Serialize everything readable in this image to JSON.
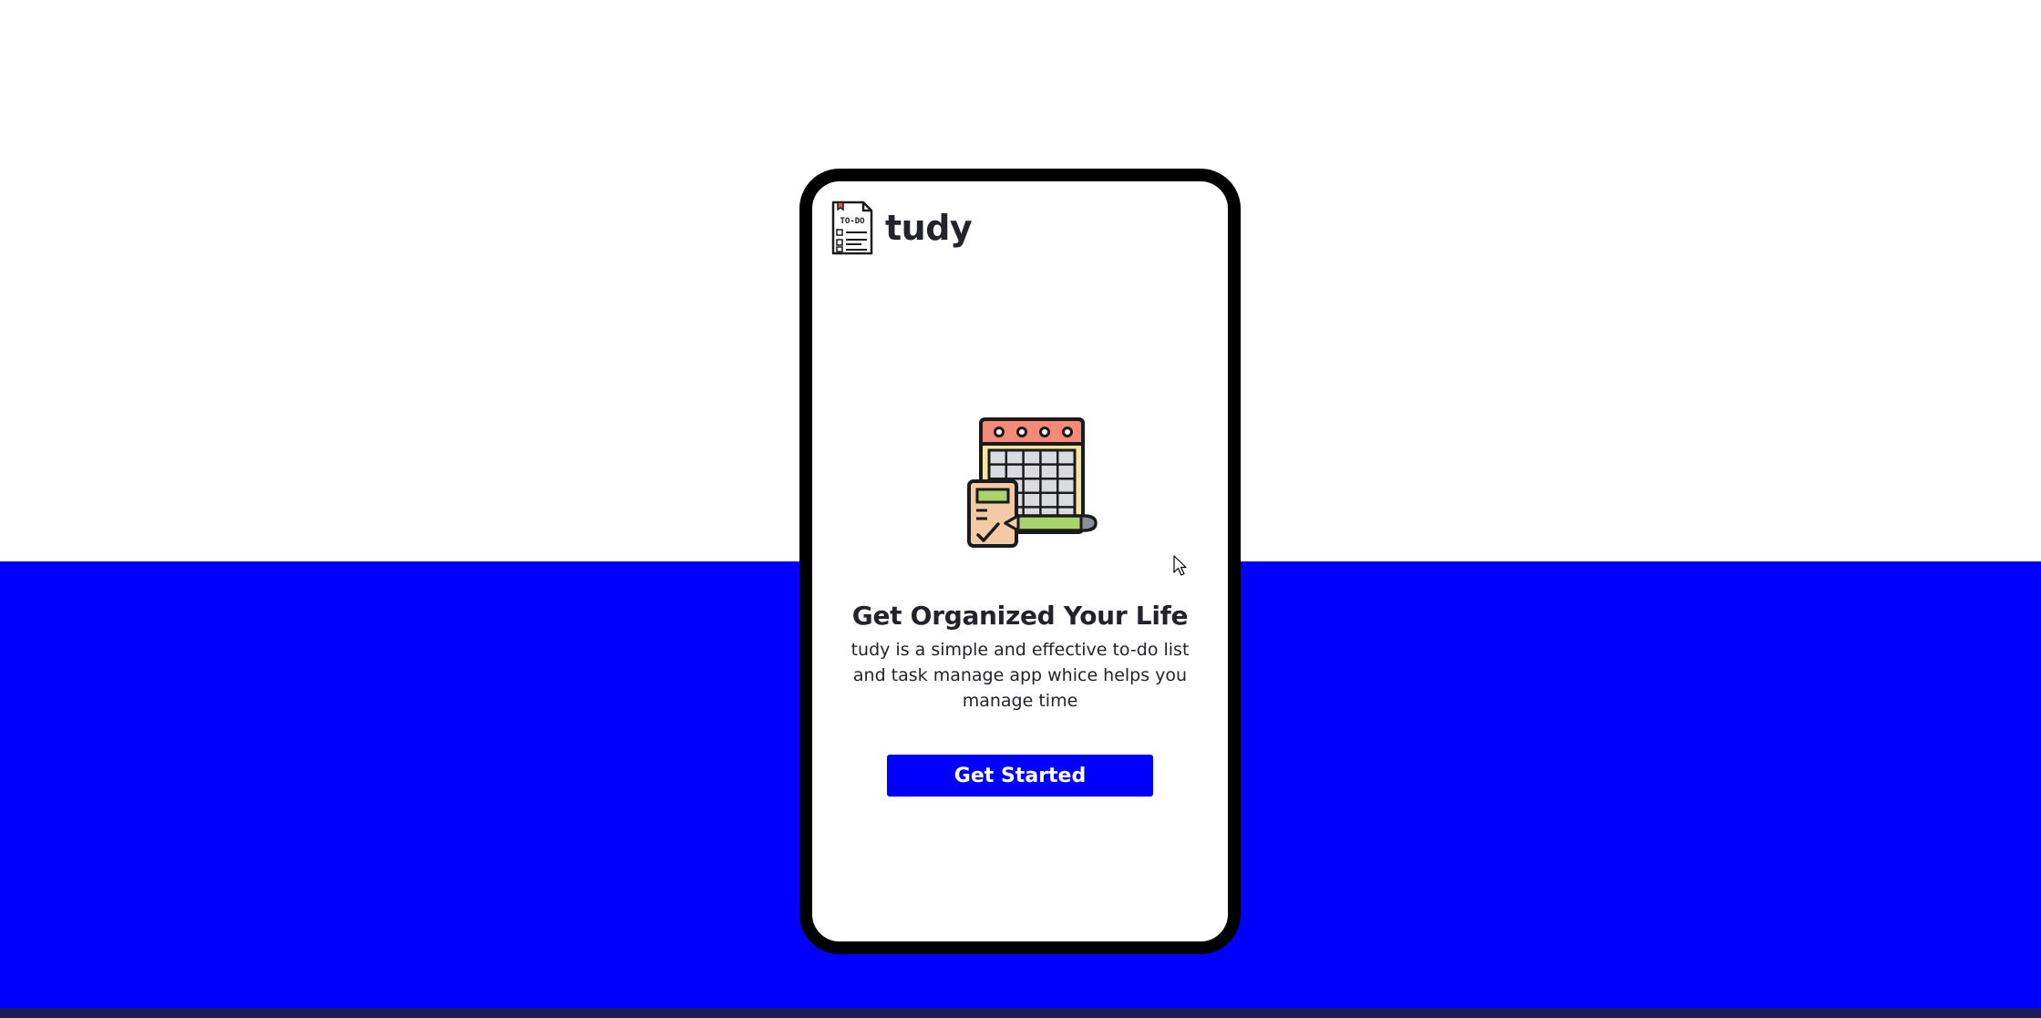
{
  "app": {
    "brand_name": "tudy",
    "logo_icon": "todo-list-icon",
    "logo_text": "TO-DO"
  },
  "hero": {
    "illustration_icon": "calendar-planner-icon",
    "headline": "Get Organized Your Life",
    "description": "tudy is a simple and effective to-do list and task manage app whice helps you manage time"
  },
  "cta": {
    "label": "Get Started"
  },
  "colors": {
    "primary": "#0000fe",
    "background": "#ffffff",
    "phone_frame": "#000000",
    "text": "#23232b",
    "footer_strip": "#1b1d55"
  }
}
